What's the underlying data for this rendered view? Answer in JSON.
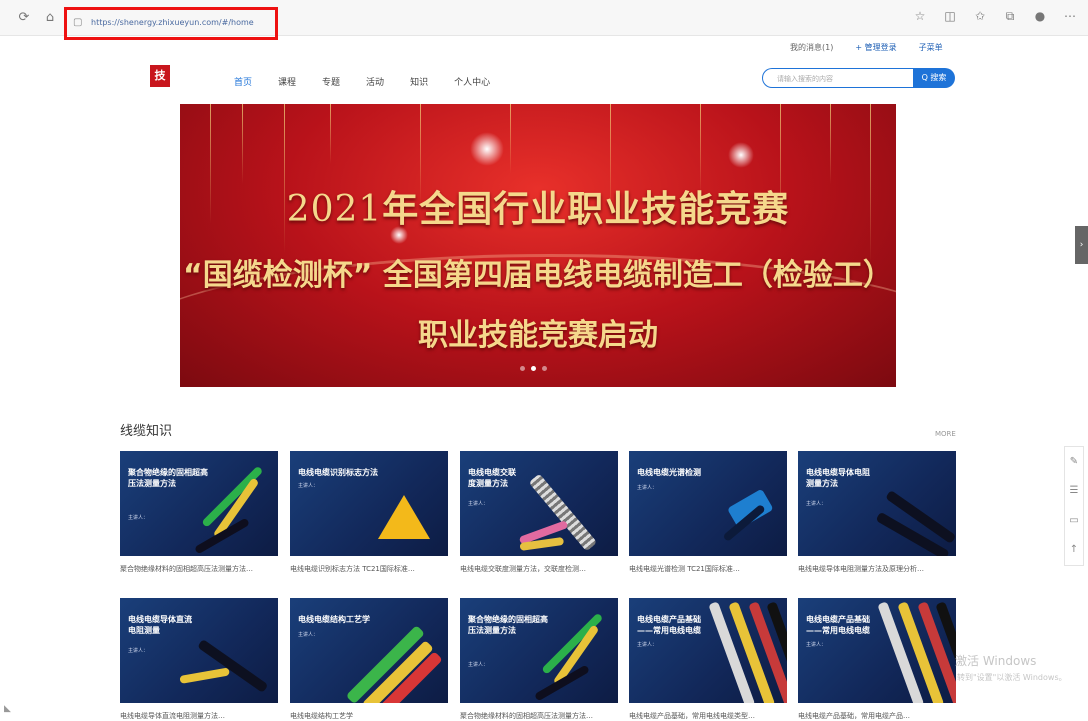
{
  "browser": {
    "url": "https://shenergy.zhixueyun.com/#/home",
    "icons": [
      "refresh-icon",
      "home-icon",
      "lock-icon",
      "star-icon",
      "split-icon",
      "favorites-icon",
      "collections-icon",
      "profile-icon",
      "more-icon"
    ]
  },
  "top_links": [
    "我的消息(1)",
    "+ 管理登录",
    "子菜单"
  ],
  "logo": "技",
  "nav": {
    "items": [
      "首页",
      "课程",
      "专题",
      "活动",
      "知识",
      "个人中心"
    ],
    "active": "首页"
  },
  "search": {
    "placeholder": "请输入搜索的内容",
    "button": "Q 搜索"
  },
  "banner": {
    "year": "2021",
    "line1": "年全国行业职业技能竞赛",
    "line2": "“国缆检测杯” 全国第四届电线电缆制造工（检验工）",
    "line3": "职业技能竞赛启动"
  },
  "section": {
    "title": "线缆知识",
    "more": "MORE"
  },
  "cards": [
    {
      "title": "聚合物绝缘的固相超高压法测量方法",
      "sub1": "主讲人：",
      "sub2": "",
      "caption": "聚合物绝缘材料的固相超高压法测量方法…"
    },
    {
      "title": "电线电缆识别标志方法",
      "sub1": "主讲人：",
      "sub2": "",
      "caption": "电线电缆识别标志方法 TC21国际标准…"
    },
    {
      "title": "电线电缆交联度测量方法",
      "sub1": "主讲人：",
      "sub2": "",
      "caption": "电线电缆交联度测量方法，交联度检测…"
    },
    {
      "title": "电线电缆光谱检测",
      "sub1": "主讲人：",
      "sub2": "",
      "caption": "电线电缆光谱检测 TC21国际标准…"
    },
    {
      "title": "电线电缆导体电阻测量方法",
      "sub1": "主讲人：",
      "sub2": "",
      "caption": "电线电缆导体电阻测量方法及原理分析…"
    },
    {
      "title": "电线电缆导体直流电阻测量",
      "sub1": "主讲人：",
      "sub2": "",
      "caption": "电线电缆导体直流电阻测量方法…"
    },
    {
      "title": "电线电缆结构工艺学",
      "sub1": "主讲人：",
      "sub2": "",
      "caption": "电线电缆结构工艺学"
    },
    {
      "title": "聚合物绝缘的固相超高压法测量方法",
      "sub1": "主讲人：",
      "sub2": "",
      "caption": "聚合物绝缘材料的固相超高压法测量方法…"
    },
    {
      "title": "电线电缆产品基础——常用电线电缆",
      "sub1": "主讲人：",
      "sub2": "",
      "caption": "电线电缆产品基础，常用电线电缆类型…"
    },
    {
      "title": "电线电缆产品基础——常用电线电缆",
      "sub1": "主讲人：",
      "sub2": "",
      "caption": "电线电缆产品基础，常用电缆产品…"
    }
  ],
  "watermark": {
    "line1": "激活 Windows",
    "line2": "转到\"设置\"以激活 Windows。"
  }
}
